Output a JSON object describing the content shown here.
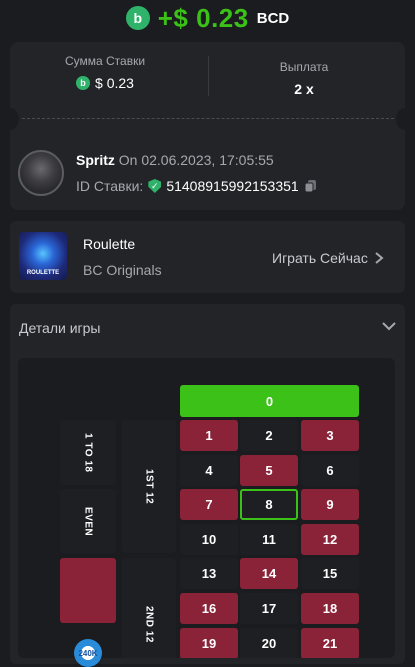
{
  "payout": {
    "amount": "+$ 0.23",
    "currency": "BCD"
  },
  "bet_stats": {
    "amount_label": "Сумма Ставки",
    "amount_value": "$ 0.23",
    "payout_label": "Выплата",
    "payout_value": "2 x"
  },
  "user": {
    "name": "Spritz",
    "date": "On 02.06.2023, 17:05:55",
    "bet_id_label": "ID Ставки:",
    "bet_id": "51408915992153351"
  },
  "game": {
    "title": "Roulette",
    "subtitle": "BC Originals",
    "thumb_label": "ROULETTE",
    "play_label": "Играть Сейчас"
  },
  "details": {
    "title": "Детали игры"
  },
  "board": {
    "zero": "0",
    "outside": [
      "1 TO 18",
      "EVEN"
    ],
    "dozens": [
      "1ST 12",
      "2ND 12"
    ],
    "selected": "8",
    "numbers": [
      {
        "n": "1",
        "c": "red"
      },
      {
        "n": "2",
        "c": "black"
      },
      {
        "n": "3",
        "c": "red"
      },
      {
        "n": "4",
        "c": "black"
      },
      {
        "n": "5",
        "c": "red"
      },
      {
        "n": "6",
        "c": "black"
      },
      {
        "n": "7",
        "c": "red"
      },
      {
        "n": "8",
        "c": "black"
      },
      {
        "n": "9",
        "c": "red"
      },
      {
        "n": "10",
        "c": "black"
      },
      {
        "n": "11",
        "c": "black"
      },
      {
        "n": "12",
        "c": "red"
      },
      {
        "n": "13",
        "c": "black"
      },
      {
        "n": "14",
        "c": "red"
      },
      {
        "n": "15",
        "c": "black"
      },
      {
        "n": "16",
        "c": "red"
      },
      {
        "n": "17",
        "c": "black"
      },
      {
        "n": "18",
        "c": "red"
      },
      {
        "n": "19",
        "c": "red"
      },
      {
        "n": "20",
        "c": "black"
      },
      {
        "n": "21",
        "c": "red"
      }
    ],
    "chip_label": "240K"
  },
  "colors": {
    "accent": "#3bc117",
    "red": "#8a2238",
    "black": "#1e1f23",
    "bg": "#1b1c20"
  }
}
